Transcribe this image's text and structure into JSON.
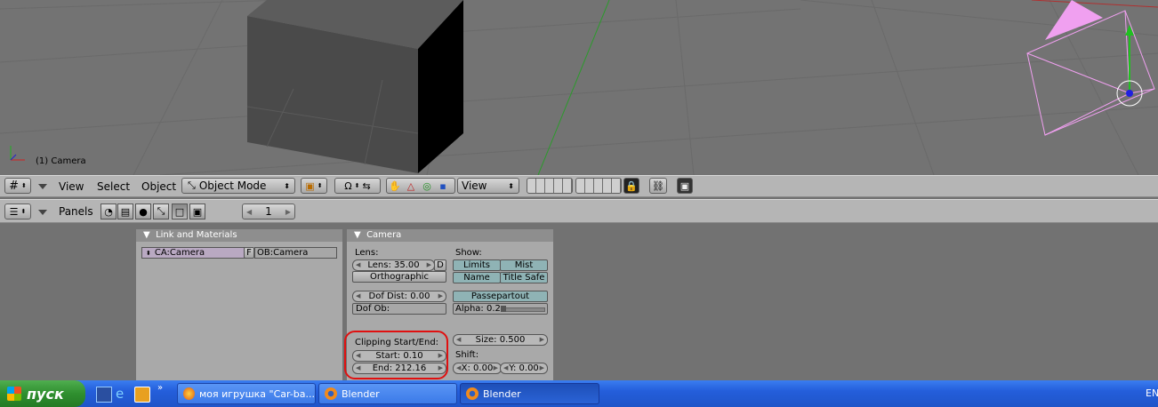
{
  "viewport": {
    "object_label": "(1) Camera"
  },
  "header3d": {
    "menu_view": "View",
    "menu_select": "Select",
    "menu_object": "Object",
    "mode_select": "Object Mode",
    "orientation_select": "View"
  },
  "buttons_header": {
    "panels_label": "Panels",
    "frame_number": "1"
  },
  "link_panel": {
    "title": "Link and Materials",
    "ca_field": "CA:Camera",
    "f_button": "F",
    "ob_field": "OB:Camera"
  },
  "camera_panel": {
    "title": "Camera",
    "lens_label": "Lens:",
    "lens_field": "Lens: 35.00",
    "d_button": "D",
    "orthographic": "Orthographic",
    "dof_dist": "Dof Dist: 0.00",
    "dof_ob": "Dof Ob:",
    "clipping_label": "Clipping Start/End:",
    "clip_start": "Start: 0.10",
    "clip_end": "End: 212.16",
    "show_label": "Show:",
    "limits": "Limits",
    "mist": "Mist",
    "name": "Name",
    "title_safe": "Title Safe",
    "passepartout": "Passepartout",
    "alpha": "Alpha: 0.2",
    "size": "Size: 0.500",
    "shift_label": "Shift:",
    "shift_x": "X: 0.00",
    "shift_y": "Y: 0.00"
  },
  "taskbar": {
    "start": "пуск",
    "tasks": [
      "моя игрушка \"Car-ba...",
      "Blender",
      "Blender"
    ],
    "language": "EN"
  },
  "colors": {
    "viewport_bg": "#737373",
    "header_bg": "#b5b5b5",
    "panel_bg": "#a9a9a9",
    "camera_wire": "#f0a0f0",
    "highlight_circle": "#e01010",
    "taskbar_blue": "#245edb",
    "start_green": "#2f8f2f"
  }
}
